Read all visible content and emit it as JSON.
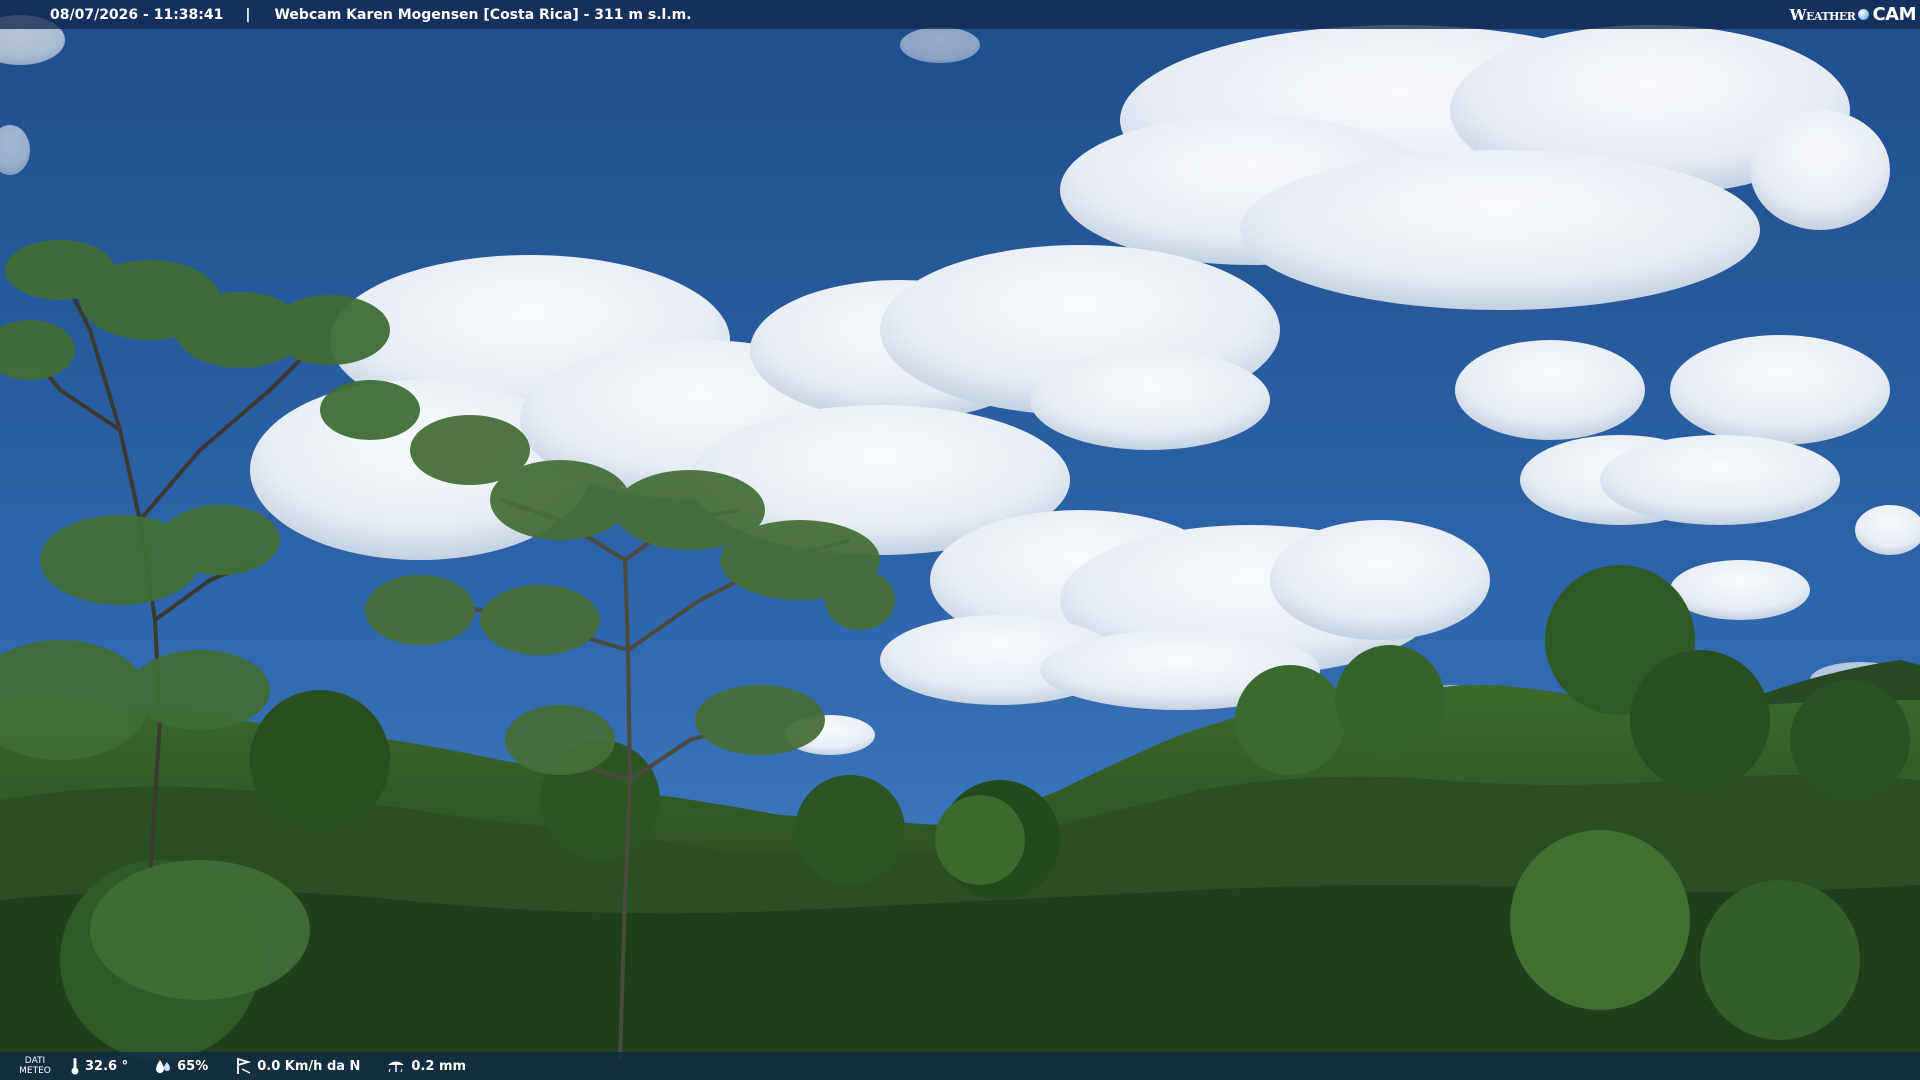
{
  "overlay": {
    "datetime": "08/07/2026 - 11:38:41",
    "separator": "|",
    "title": "Webcam Karen Mogensen [Costa Rica] - 311 m s.l.m.",
    "brand_weather": "Weather",
    "brand_cam": "CAM"
  },
  "weather": {
    "label_line1": "DATI",
    "label_line2": "METEO",
    "temperature": "32.6 °",
    "humidity": "65%",
    "wind": "0.0 Km/h da N",
    "rain": "0.2 mm",
    "icons": [
      "thermometer-icon",
      "humidity-icon",
      "wind-icon",
      "rain-icon"
    ]
  },
  "colors": {
    "sky_top": "#1f4e8c",
    "sky_bottom": "#3d7ac4",
    "cloud": "#f4f7fb",
    "forest_dark": "#1e3a1a",
    "forest_mid": "#2f5a25",
    "forest_light": "#4d7a38"
  }
}
